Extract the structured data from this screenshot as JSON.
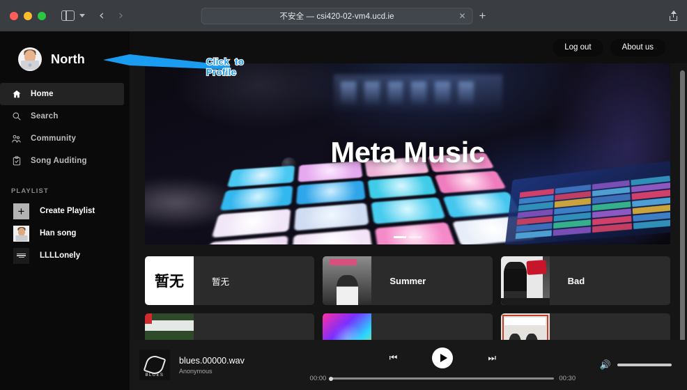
{
  "browser": {
    "tab_title": "不安全 — csi420-02-vm4.ucd.ie",
    "close_tab_label": "✕",
    "new_tab_label": "+",
    "back_label": "‹",
    "forward_label": "›",
    "traffic_lights": [
      "close",
      "minimize",
      "zoom"
    ]
  },
  "sidebar": {
    "username": "North",
    "avatar_name": "user-avatar",
    "nav_items": [
      {
        "label": "Home",
        "icon": "home-icon",
        "active": true
      },
      {
        "label": "Search",
        "icon": "search-icon",
        "active": false
      },
      {
        "label": "Community",
        "icon": "community-icon",
        "active": false
      },
      {
        "label": "Song Auditing",
        "icon": "clipboard-check-icon",
        "active": false
      }
    ],
    "playlist_header": "PLAYLIST",
    "playlist_items": [
      {
        "label": "Create Playlist",
        "thumb": "plus-icon"
      },
      {
        "label": "Han song",
        "thumb": "han-song-cover"
      },
      {
        "label": "LLLLonely",
        "thumb": "llllonely-cover"
      }
    ]
  },
  "topbar": {
    "logout_label": "Log out",
    "about_label": "About us"
  },
  "hero": {
    "title": "Meta Music",
    "carousel_dots": 2,
    "active_dot": 0
  },
  "songs": [
    {
      "title": "暂无",
      "cover": "blank-cover",
      "cover_text": "暂无"
    },
    {
      "title": "Summer",
      "cover": "summer-cover",
      "cover_text": ""
    },
    {
      "title": "Bad",
      "cover": "bad-cover",
      "cover_text": ""
    },
    {
      "title": "",
      "cover": "one-direction-cover",
      "cover_text": ""
    },
    {
      "title": "",
      "cover": "colorful-cover",
      "cover_text": ""
    },
    {
      "title": "",
      "cover": "one-direction-2-cover",
      "cover_text": ""
    }
  ],
  "player": {
    "track_title": "blues.00000.wav",
    "artist": "Anonymous",
    "art_label": "BLUES",
    "prev_label": "⏮",
    "play_label": "play",
    "next_label": "⏭",
    "current_time": "00:00",
    "total_time": "00:30",
    "progress_percent": 0,
    "volume_percent": 100
  },
  "annotation": {
    "line1": "Click  to",
    "line2": "Profile",
    "color": "#1a9cf0"
  },
  "colors": {
    "sidebar_bg": "#0a0a0a",
    "main_bg": "#151515",
    "card_bg": "#2b2b2b",
    "player_bg": "#181818",
    "accent": "#1a9cf0"
  }
}
